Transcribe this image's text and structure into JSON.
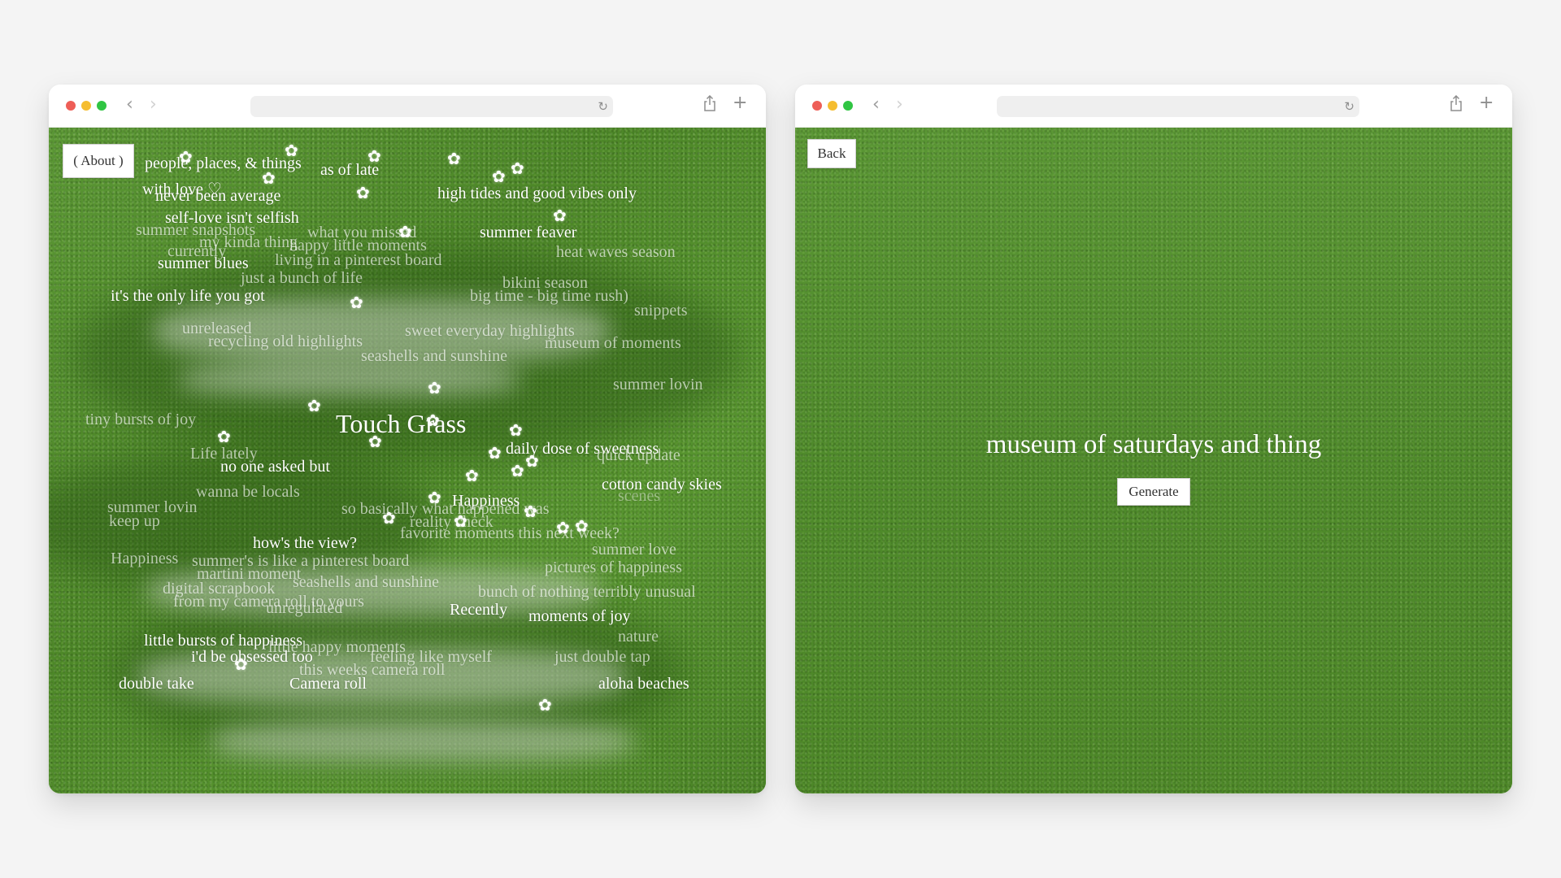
{
  "windows": {
    "left": {
      "about_label": "( About )",
      "title": "Touch Grass",
      "phrases": [
        "people, places, & things",
        "as of late",
        "with love ♡",
        "never been average",
        "high tides and good vibes only",
        "self-love isn't selfish",
        "summer feaver",
        "summer snapshots",
        "what you missed",
        "my kinda thing",
        "currently",
        "happy little moments",
        "summer blues",
        "living in a pinterest board",
        "heat waves season",
        "just a bunch of life",
        "bikini season",
        "it's the only life you got",
        "big time - big time rush)",
        "snippets",
        "unreleased",
        "sweet everyday highlights",
        "recycling old highlights",
        "museum of moments",
        "seashells and sunshine",
        "summer lovin",
        "tiny bursts of joy",
        "Life lately",
        "daily dose of sweetness",
        "quick update",
        "no one asked but",
        "cotton candy skies",
        "wanna be locals",
        "Happiness",
        "scenes",
        "summer lovin",
        "so basically what happened was",
        "keep up",
        "reality check",
        "how's the view?",
        "favorite moments this next week?",
        "Happiness",
        "summer's is like a pinterest board",
        "summer love",
        "martini moment",
        "seashells and sunshine",
        "pictures of happiness",
        "digital scrapbook",
        "bunch of nothing terribly unusual",
        "from my camera roll to yours",
        "unregulated",
        "Recently",
        "moments of joy",
        "little bursts of happiness",
        "nature",
        "little happy moments",
        "i'd be obsessed too",
        "feeling like myself",
        "just double tap",
        "this weeks camera roll",
        "double take",
        "Camera roll",
        "aloha beaches"
      ]
    },
    "right": {
      "back_label": "Back",
      "title": "museum of saturdays and thing",
      "generate_label": "Generate"
    }
  },
  "browser": {
    "nav_back_icon": "chevron-left-icon",
    "nav_forward_icon": "chevron-right-icon",
    "reload_icon": "reload-icon",
    "share_icon": "share-icon",
    "new_tab_icon": "plus-icon"
  },
  "colors": {
    "grass": "#4f8b2a",
    "text": "#ffffff",
    "button_bg": "#ffffff"
  }
}
